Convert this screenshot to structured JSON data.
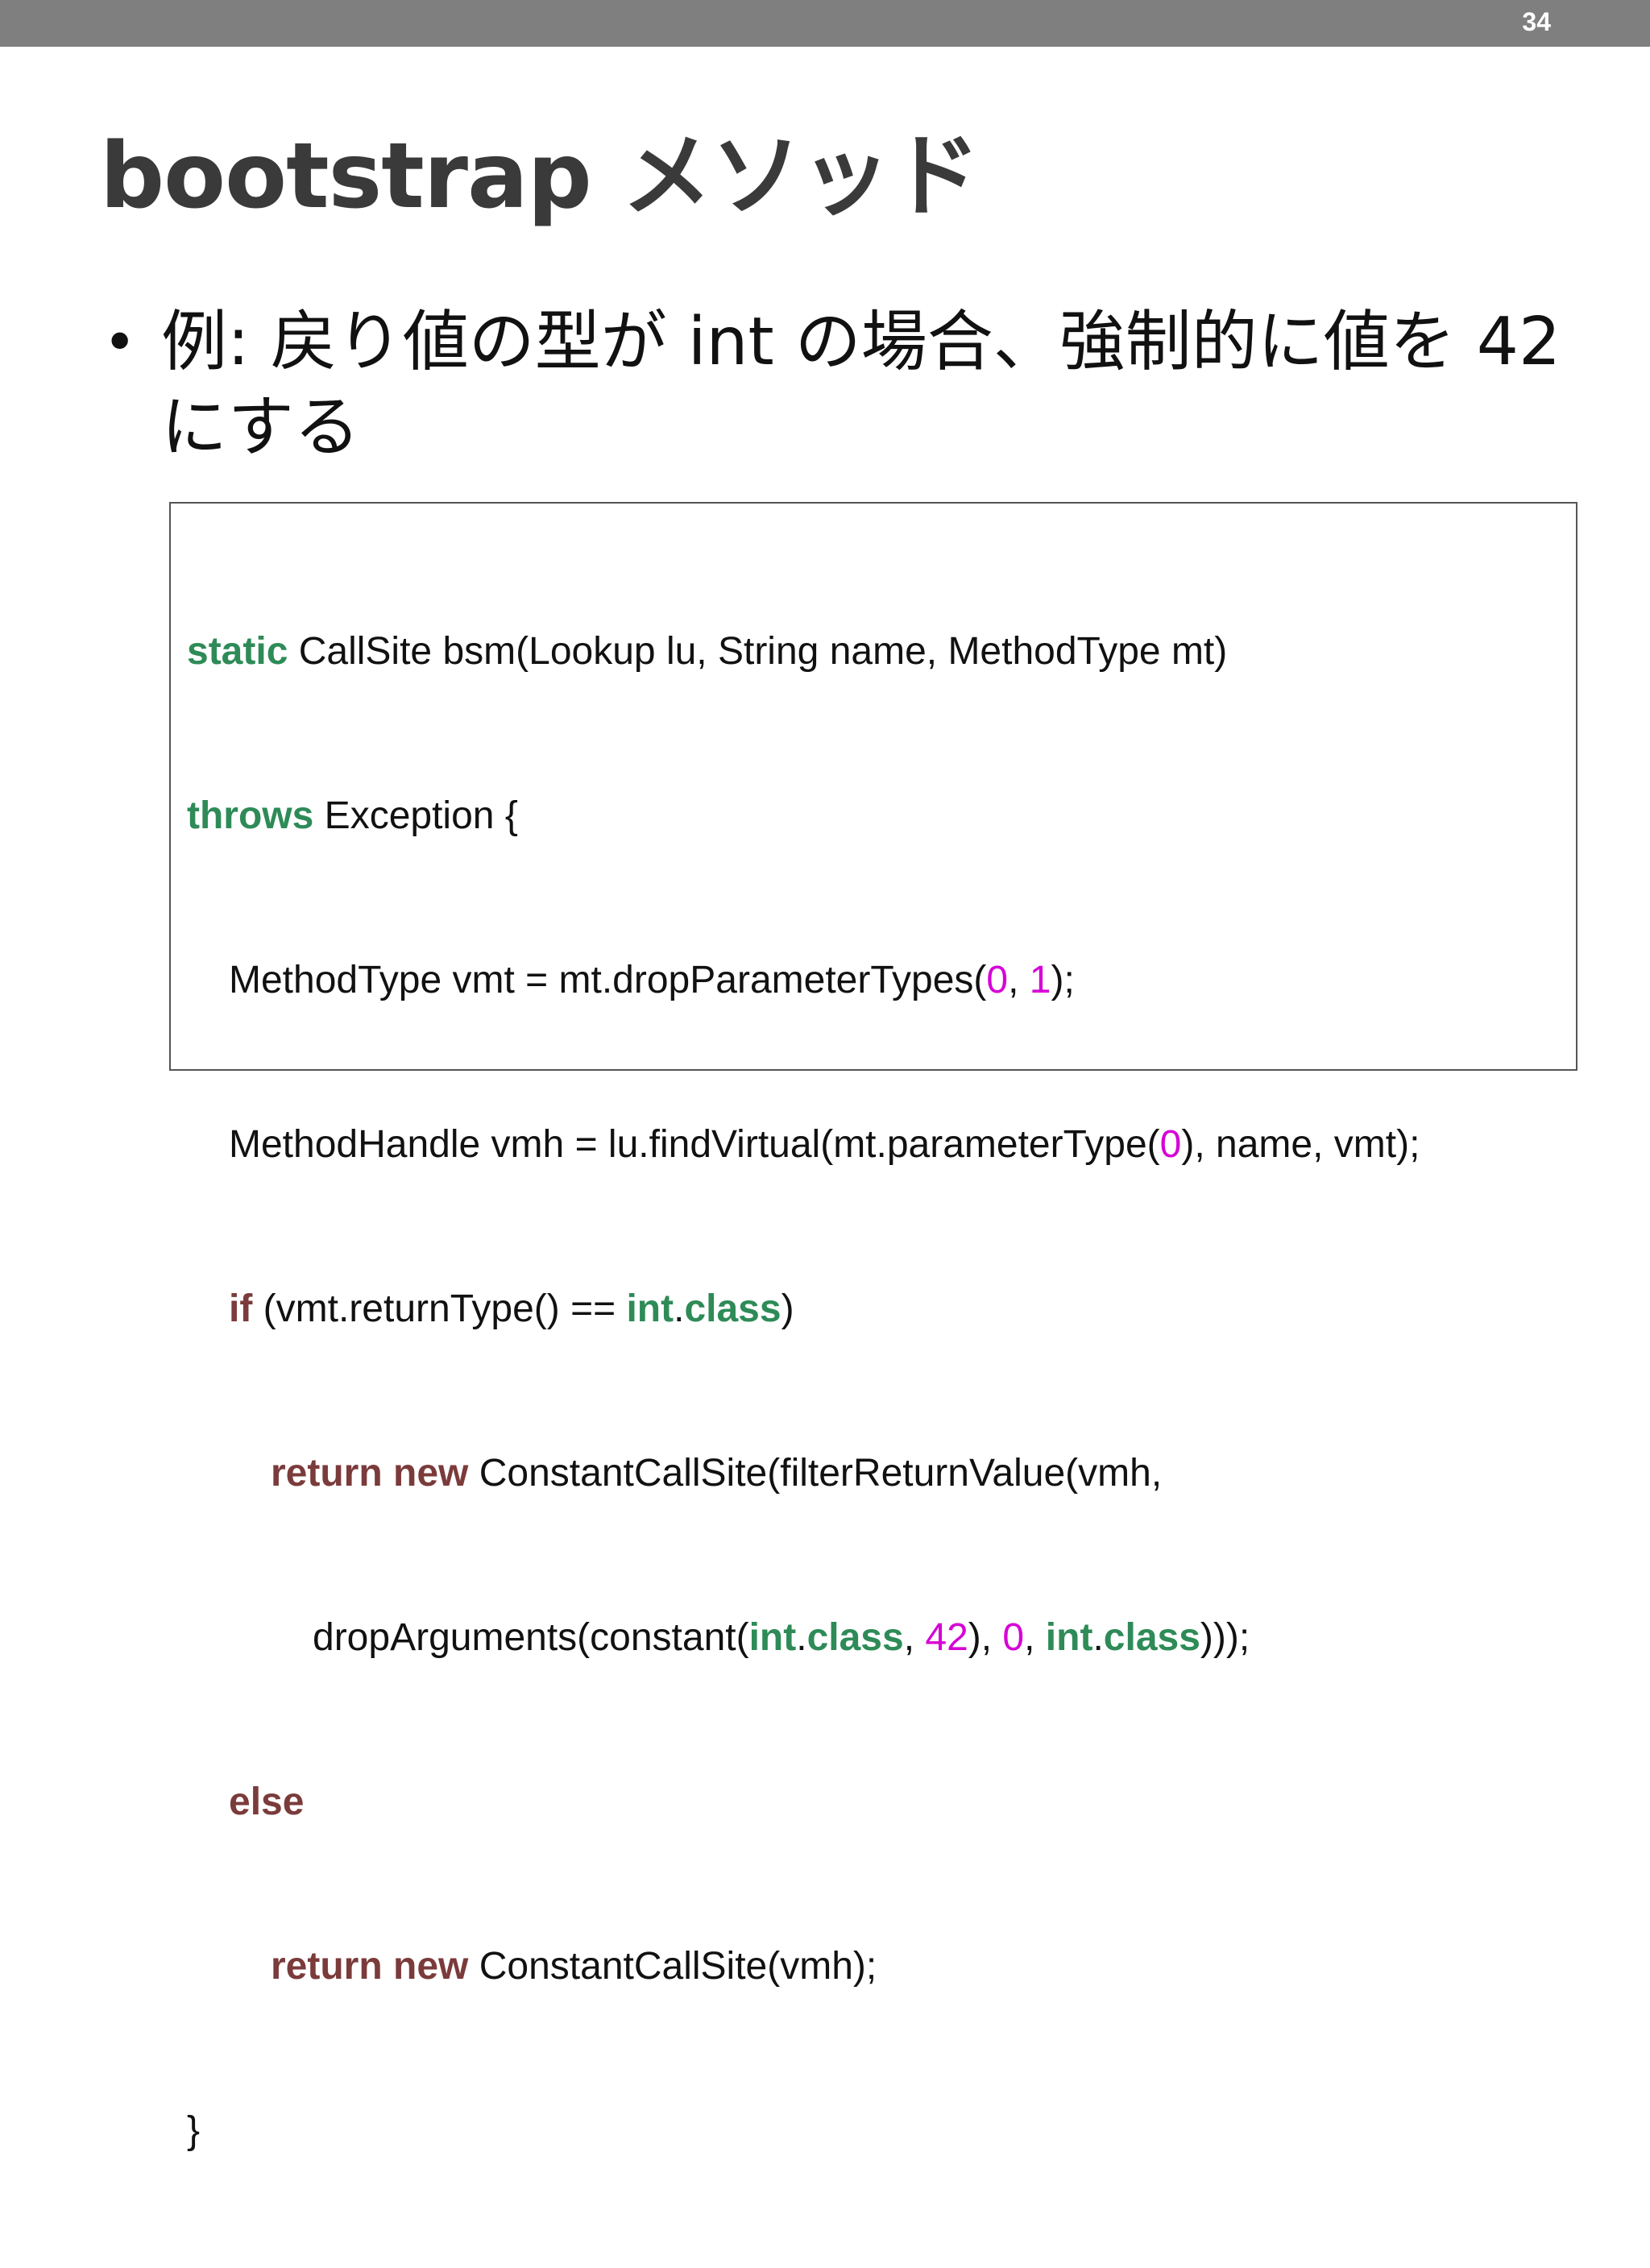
{
  "slide": {
    "page_number": "34",
    "title": "bootstrap メソッド",
    "bullet": "例: 戻り値の型が int の場合、強制的に値を 42 にする"
  },
  "code": {
    "l1": {
      "kw": "static",
      "rest": " CallSite bsm(Lookup lu, String name, MethodType mt)"
    },
    "l2": {
      "kw": "throws",
      "rest": " Exception {"
    },
    "l3": {
      "a": "MethodType vmt = mt.dropParameterTypes(",
      "n1": "0",
      "b": ", ",
      "n2": "1",
      "c": ");"
    },
    "l4": {
      "a": "MethodHandle vmh = lu.findVirtual(mt.parameterType(",
      "n1": "0",
      "b": "), name, vmt);"
    },
    "l5": {
      "kw": "if",
      "a": " (vmt.returnType() == ",
      "t1": "int",
      "dot": ".",
      "t2": "class",
      "b": ")"
    },
    "l6": {
      "kw1": "return",
      "sp": " ",
      "kw2": "new",
      "rest": " ConstantCallSite(filterReturnValue(vmh,"
    },
    "l7": {
      "a": "dropArguments(constant(",
      "t1": "int",
      "d1": ".",
      "t2": "class",
      "b": ", ",
      "n1": "42",
      "c": "), ",
      "n2": "0",
      "d": ", ",
      "t3": "int",
      "d2": ".",
      "t4": "class",
      "e": ")));"
    },
    "l8": {
      "kw": "else"
    },
    "l9": {
      "kw1": "return",
      "sp": " ",
      "kw2": "new",
      "rest": " ConstantCallSite(vmh);"
    },
    "l10": {
      "rest": "}"
    }
  }
}
